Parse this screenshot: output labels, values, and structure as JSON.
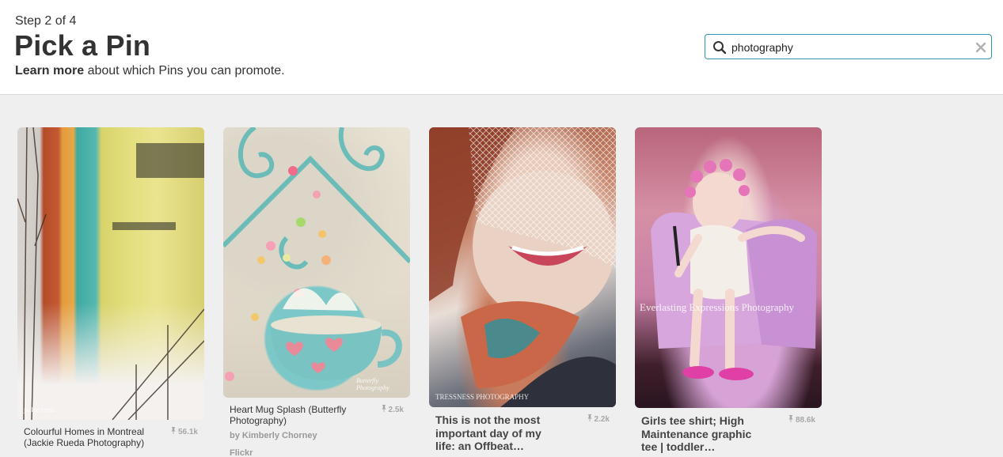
{
  "header": {
    "step": "Step 2 of 4",
    "title": "Pick a Pin",
    "learn_more": "Learn more",
    "learn_rest": " about which Pins you can promote."
  },
  "search": {
    "value": "photography",
    "placeholder": "",
    "icon": "search-icon",
    "clear_icon": "close-icon",
    "border_color": "#2f99a8"
  },
  "pins": [
    {
      "title": "Colourful Homes in Montreal (Jackie Rueda Photography)",
      "repins": "56.1k",
      "watermark": "jackie rueda"
    },
    {
      "title": "Heart Mug Splash (Butterfly Photography)",
      "repins": "2.5k",
      "by": "by Kimberly Chorney",
      "source": "Flickr",
      "watermark": "Butterfly Photography"
    },
    {
      "title": "This is not the most important day of my life: an Offbeat…",
      "repins": "2.2k",
      "watermark": "TRESSNESS PHOTOGRAPHY"
    },
    {
      "title": "Girls tee shirt; High Maintenance graphic tee | toddler…",
      "repins": "88.6k",
      "watermark": "Everlasting Expressions Photography"
    }
  ]
}
